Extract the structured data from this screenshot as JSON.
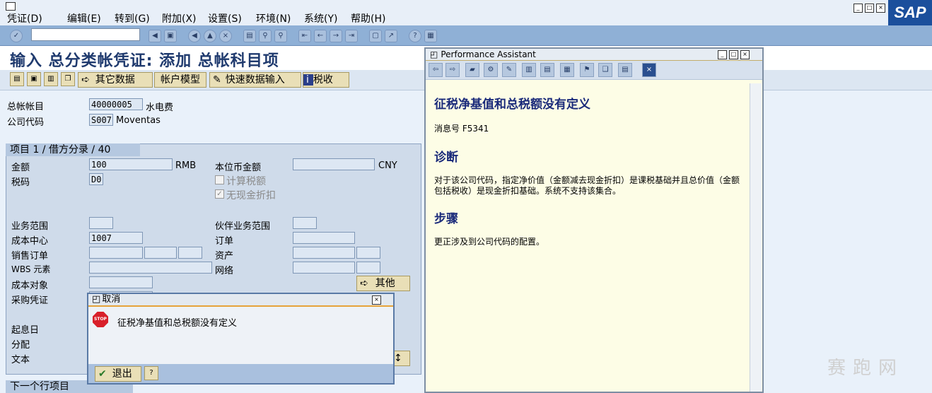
{
  "menu": [
    "凭证(D)",
    "编辑(E)",
    "转到(G)",
    "附加(X)",
    "设置(S)",
    "环境(N)",
    "系统(Y)",
    "帮助(H)"
  ],
  "logo": "SAP",
  "title": "输入 总分类帐凭证: 添加 总帐科目项",
  "app_toolbar": {
    "other_data": "其它数据",
    "account_model": "帐户模型",
    "fast_entry": "快速数据输入",
    "tax": "税收"
  },
  "header": {
    "gl_account_label": "总帐帐目",
    "gl_account_value": "40000005",
    "gl_account_text": "水电费",
    "company_code_label": "公司代码",
    "company_code_value": "S007",
    "company_code_text": "Moventas"
  },
  "item_group": {
    "title": "项目 1 / 借方分录 / 40",
    "amount_label": "金额",
    "amount_value": "100",
    "amount_currency": "RMB",
    "local_amount_label": "本位币金额",
    "local_currency": "CNY",
    "tax_code_label": "税码",
    "tax_code_value": "D0",
    "calc_tax_label": "计算税额",
    "no_cash_discount_label": "无现金折扣",
    "business_area_label": "业务范围",
    "partner_ba_label": "伙伴业务范围",
    "cost_center_label": "成本中心",
    "cost_center_value": "1007",
    "order_label": "订单",
    "sales_order_label": "销售订单",
    "asset_label": "资产",
    "wbs_label": "WBS 元素",
    "network_label": "网络",
    "cost_object_label": "成本对象",
    "more_label": "其他",
    "po_label": "采购凭证",
    "value_date_label": "起息日",
    "assignment_label": "分配",
    "text_label": "文本"
  },
  "next_item_header": "下一个行项目",
  "perf_assistant": {
    "title": "Performance Assistant",
    "heading": "征税净基值和总税额没有定义",
    "message_no": "消息号 F5341",
    "diagnosis_title": "诊断",
    "diagnosis_text": "对于该公司代码，指定净价值（金额减去现金折扣）是课税基础并且总价值（金额包括税收）是现金折扣基础。系统不支持该集合。",
    "procedure_title": "步骤",
    "procedure_text": "更正涉及到公司代码的配置。"
  },
  "dialog": {
    "title": "取消",
    "message": "征税净基值和总税额没有定义",
    "exit_label": "退出"
  }
}
